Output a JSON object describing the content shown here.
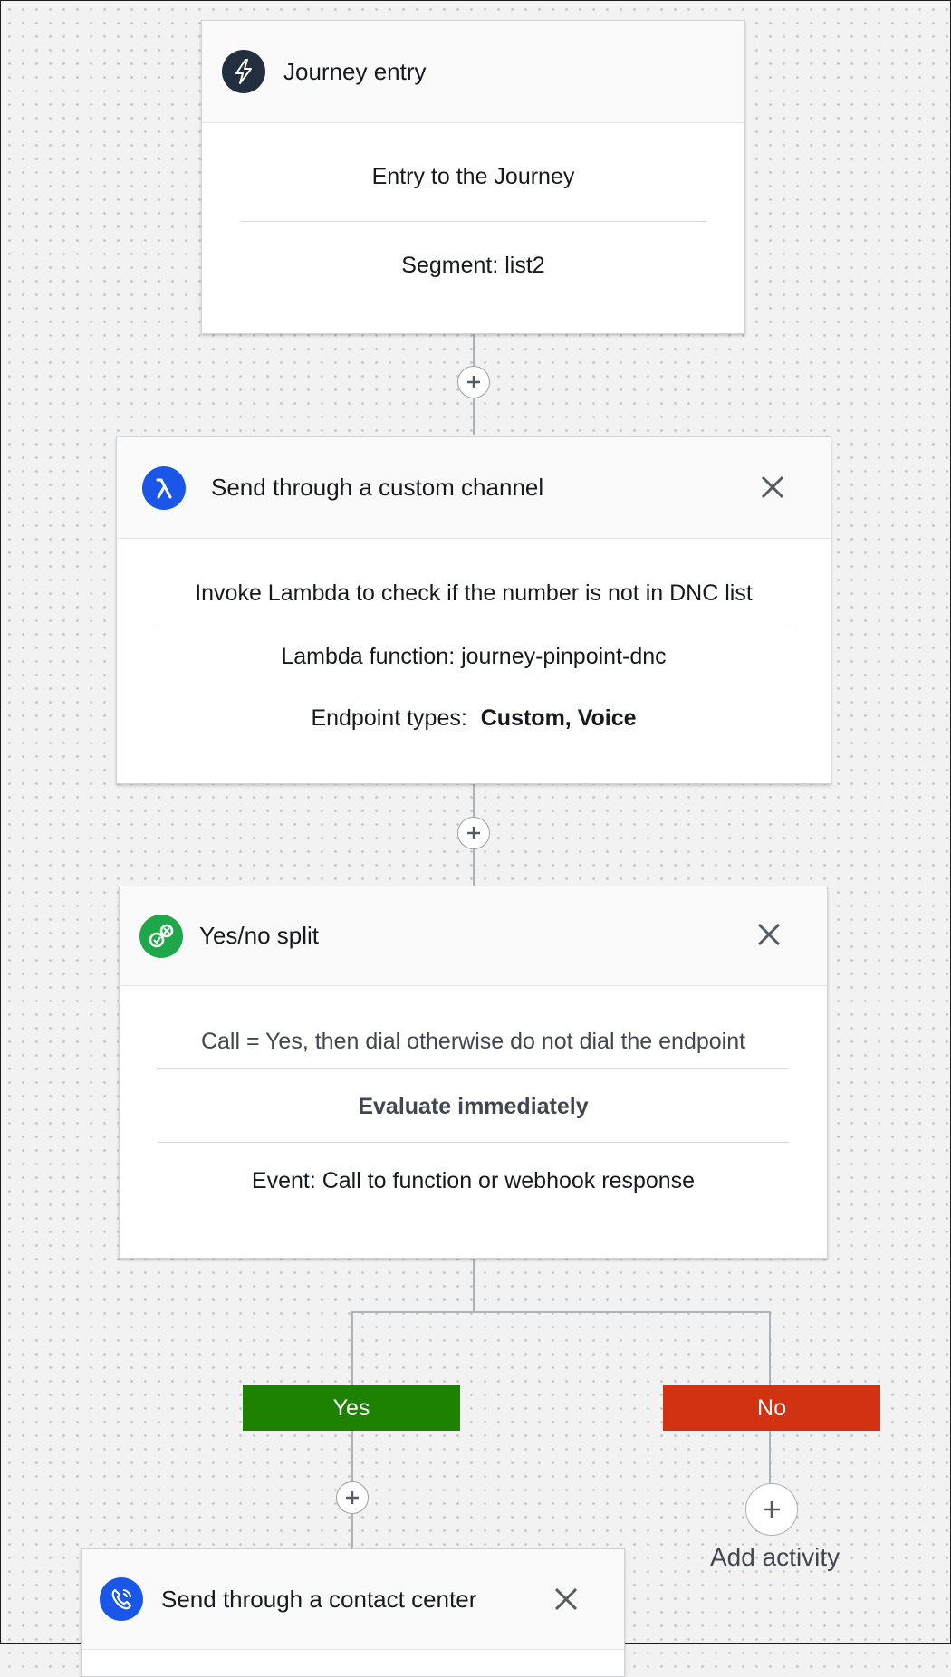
{
  "entry": {
    "title": "Journey entry",
    "description": "Entry to the Journey",
    "segment": "Segment: list2"
  },
  "custom_channel": {
    "title": "Send through a custom channel",
    "description": "Invoke Lambda to check if the number is not in DNC list",
    "lambda": "Lambda function: journey-pinpoint-dnc",
    "endpoint_label": "Endpoint types:",
    "endpoint_value": "Custom, Voice",
    "accent": "#1a57e8"
  },
  "split": {
    "title": "Yes/no split",
    "condition": "Call = Yes, then dial otherwise do not dial the endpoint",
    "evaluate": "Evaluate immediately",
    "event": "Event:  Call to function or webhook response",
    "accent": "#1ea84a"
  },
  "branches": {
    "yes_label": "Yes",
    "no_label": "No",
    "yes_color": "#1d8102",
    "no_color": "#d13212"
  },
  "add_activity_label": "Add activity",
  "contact_center": {
    "title": "Send through a contact center",
    "accent": "#1a57e8"
  },
  "icons": {
    "entry": "lightning-icon",
    "custom_channel": "lambda-icon",
    "split": "split-icon",
    "contact_center": "phone-icon",
    "close": "close-icon",
    "add": "plus-icon"
  }
}
